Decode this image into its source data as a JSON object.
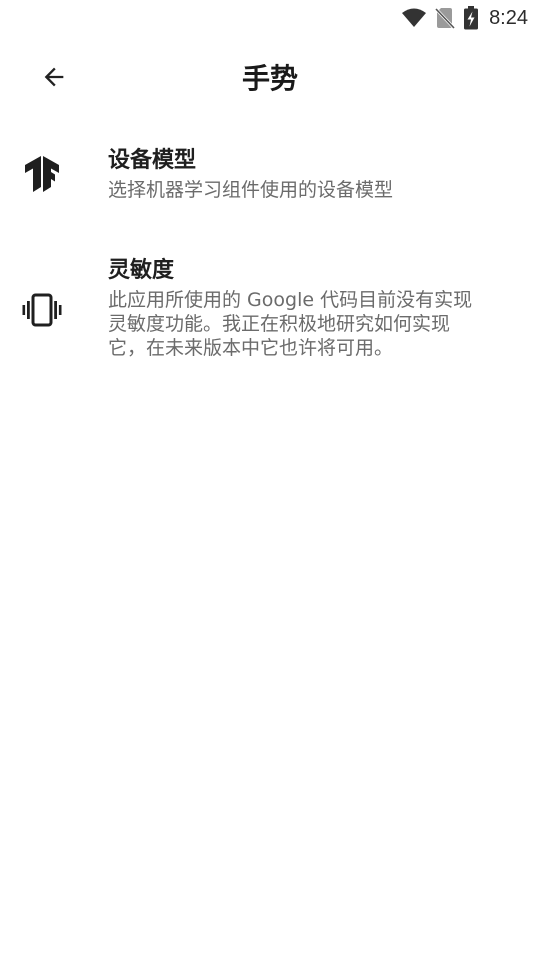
{
  "status_bar": {
    "time": "8:24",
    "icons": [
      "wifi-icon",
      "no-sim-icon",
      "battery-charging-icon"
    ]
  },
  "app_bar": {
    "title": "手势",
    "back_icon": "arrow-left-icon"
  },
  "preferences": [
    {
      "icon": "tensorflow-icon",
      "title": "设备模型",
      "summary": "选择机器学习组件使用的设备模型"
    },
    {
      "icon": "vibration-icon",
      "title": "灵敏度",
      "summary_lines": [
        "此应用所使用的 Google 代码目前没有实现",
        "灵敏度功能。我正在积极地研究如何实现",
        "它，在未来版本中它也许将可用。"
      ]
    }
  ],
  "colors": {
    "background": "#ffffff",
    "title_text": "#1a1a1a",
    "summary_text": "#6b6b6b",
    "icon": "#1f1f1f"
  }
}
